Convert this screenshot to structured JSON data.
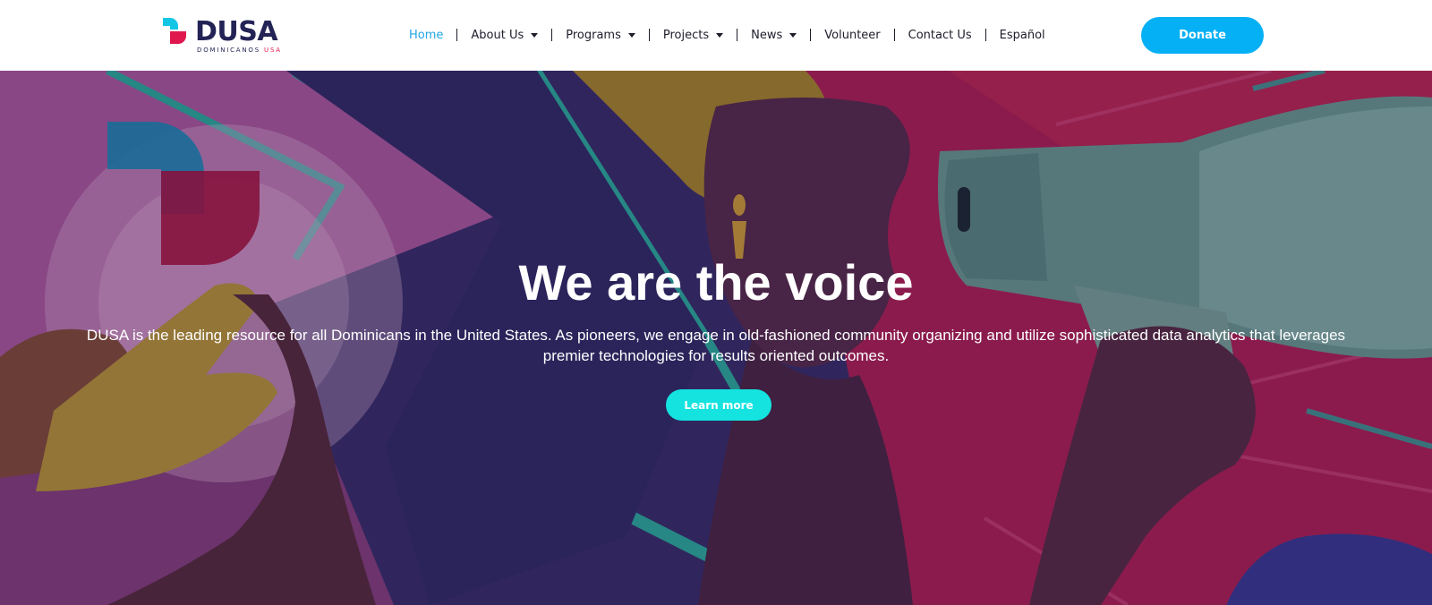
{
  "brand": {
    "name": "DUSA",
    "tagline_main": "DOMINICANOS",
    "tagline_accent": "USA"
  },
  "nav": {
    "items": [
      {
        "label": "Home",
        "active": true,
        "has_dropdown": false
      },
      {
        "label": "About Us",
        "active": false,
        "has_dropdown": true
      },
      {
        "label": "Programs",
        "active": false,
        "has_dropdown": true
      },
      {
        "label": "Projects",
        "active": false,
        "has_dropdown": true
      },
      {
        "label": "News",
        "active": false,
        "has_dropdown": true
      },
      {
        "label": "Volunteer",
        "active": false,
        "has_dropdown": false
      },
      {
        "label": "Contact Us",
        "active": false,
        "has_dropdown": false
      },
      {
        "label": "Español",
        "active": false,
        "has_dropdown": false
      }
    ],
    "donate_label": "Donate"
  },
  "hero": {
    "title": "We are the voice",
    "description": "DUSA is the leading resource for all Dominicans in the United States. As pioneers, we engage in old-fashioned community organizing and utilize sophisticated data analytics that leverages premier technologies for results oriented outcomes.",
    "cta_label": "Learn more"
  },
  "colors": {
    "accent_blue": "#06b0f5",
    "active_link": "#1fa6e6",
    "cta_cyan": "#14e3e0",
    "brand_navy": "#232356",
    "brand_pink": "#e0174f"
  },
  "icons": {
    "dropdown": "caret-down-icon"
  }
}
